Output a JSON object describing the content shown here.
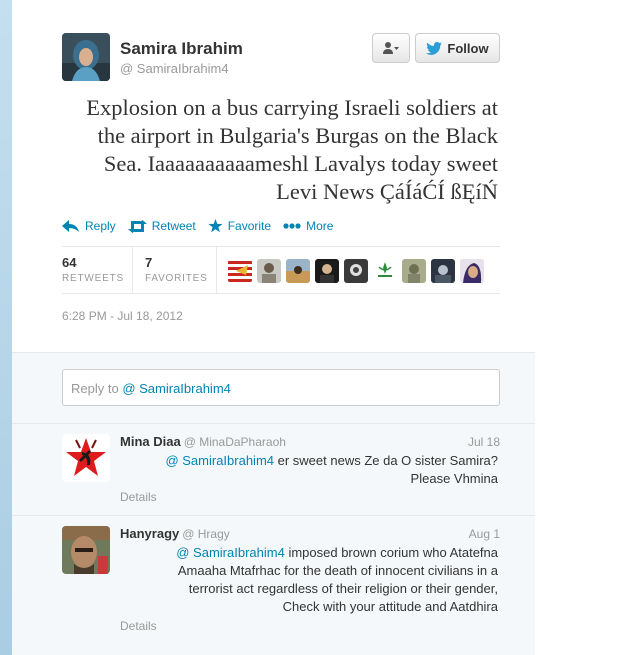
{
  "tweet": {
    "author_name": "Samira Ibrahim",
    "author_handle": "@ SamiraIbrahim4",
    "follow_label": "Follow",
    "text": "Explosion on a bus carrying Israeli soldiers at the airport in Bulgaria's Burgas on the Black Sea. Iaaaaaaaaaameshl Lavalys today sweet Levi News ÇáÍáĆÍ ßĘíŃ",
    "actions": {
      "reply": "Reply",
      "retweet": "Retweet",
      "favorite": "Favorite",
      "more": "More"
    },
    "stats": {
      "retweets_count": "64",
      "retweets_label": "RETWEETS",
      "favorites_count": "7",
      "favorites_label": "FAVORITES"
    },
    "timestamp": "6:28 PM - Jul 18, 2012"
  },
  "reply_box": {
    "prefix": "Reply to ",
    "handle": "@ SamiraIbrahim4"
  },
  "replies": [
    {
      "name": "Mina Diaa",
      "handle": "@ MinaDaPharaoh",
      "date": "Jul 18",
      "mention": "@ SamiraIbrahim4",
      "text_line1": " er sweet news Ze da O sister Samira?",
      "text_line2": "Please Vhmina",
      "details": "Details"
    },
    {
      "name": "Hanyragy",
      "handle": "@ Hragy",
      "date": "Aug 1",
      "mention": "@ SamiraIbrahim4",
      "text_line1": " imposed brown corium who Atatefna",
      "text_line2": "Amaaha Mtafrhac for the death of innocent civilians in a",
      "text_line3": "terrorist act regardless of their religion or their gender,",
      "text_line4": "Check with your attitude and Aatdhira",
      "details": "Details"
    }
  ],
  "colors": {
    "link": "#0084b4",
    "muted": "#999999",
    "text": "#333333",
    "background": "#ffffff",
    "reply_background": "#f5f8fa"
  }
}
